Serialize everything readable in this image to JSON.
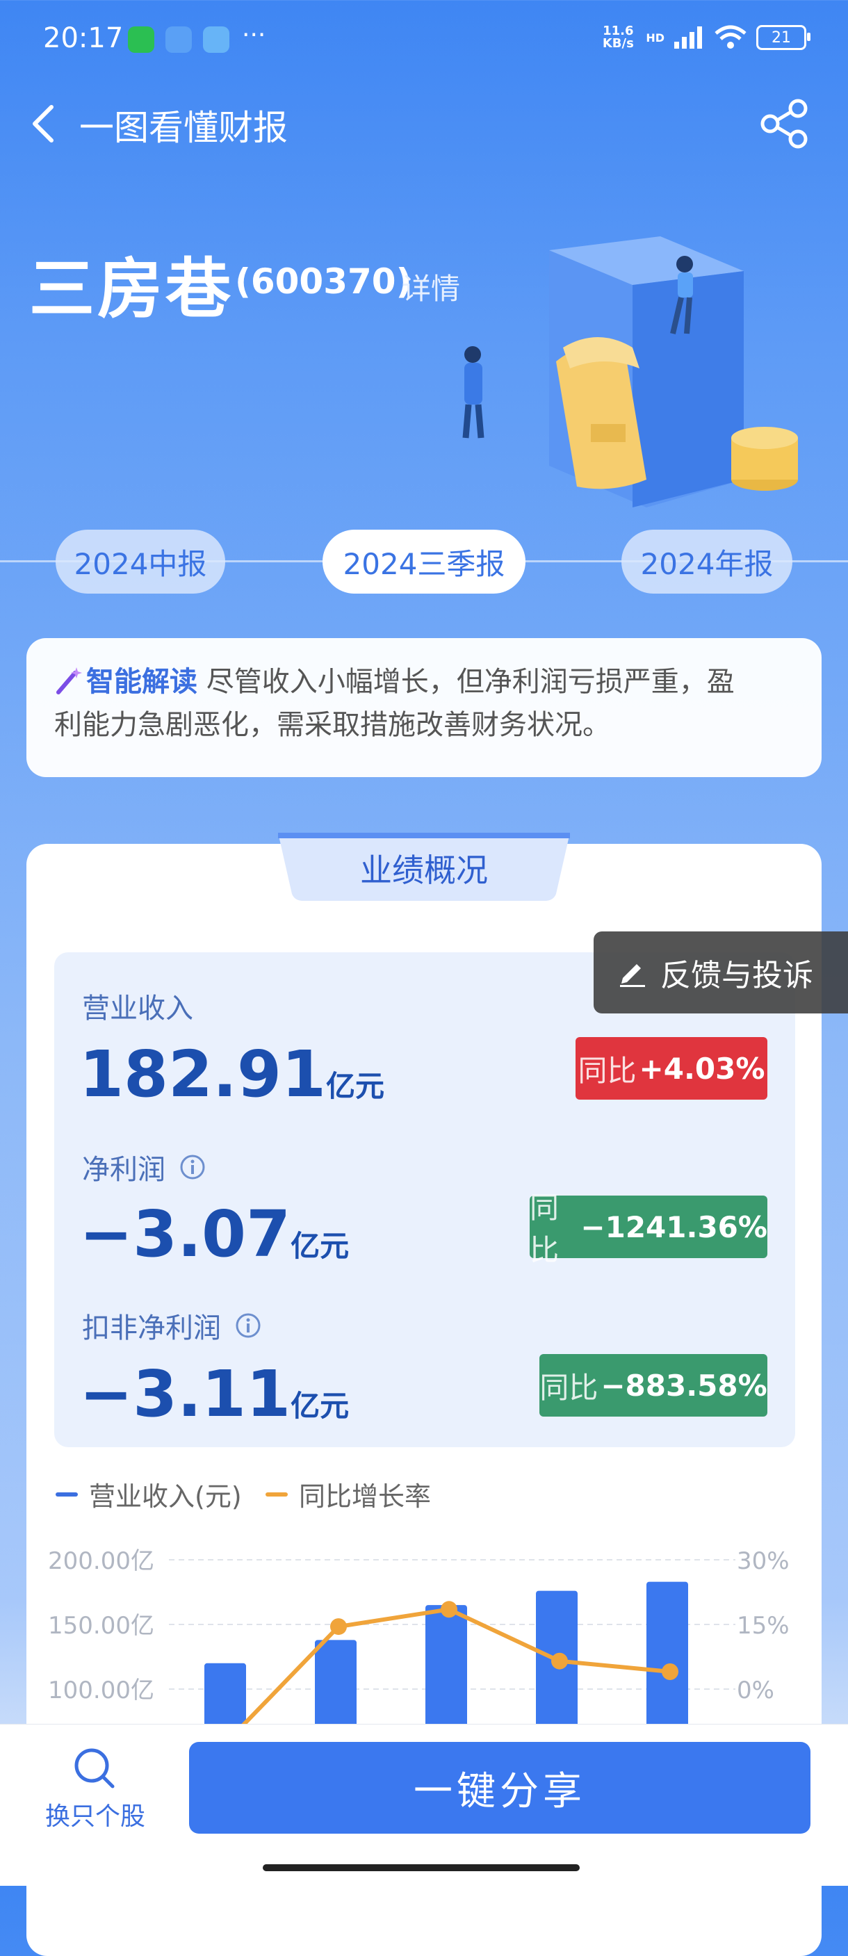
{
  "status_bar": {
    "time": "20:17",
    "network_speed": "11.6 KB/s",
    "hd": "HD",
    "battery": "21",
    "more": "···"
  },
  "header": {
    "title": "一图看懂财报",
    "back_icon": "chevron-left-icon",
    "share_icon": "share-icon"
  },
  "company": {
    "name": "三房巷",
    "code": "(600370)",
    "detail_link": "详情"
  },
  "periods": [
    {
      "label": "2024中报",
      "active": false
    },
    {
      "label": "2024三季报",
      "active": true
    },
    {
      "label": "2024年报",
      "active": false
    }
  ],
  "ai_summary": {
    "label": "智能解读",
    "line1": "尽管收入小幅增长，但净利润亏损严重，盈",
    "line2": "利能力急剧恶化，需采取措施改善财务状况。"
  },
  "section_title": "业绩概况",
  "feedback_label": "反馈与投诉",
  "metrics": [
    {
      "label": "营业收入",
      "value": "182.91",
      "unit": "亿元",
      "yoy_prefix": "同比",
      "yoy": "+4.03%",
      "color": "#e0353e"
    },
    {
      "label": "净利润",
      "value": "−3.07",
      "unit": "亿元",
      "yoy_prefix": "同比",
      "yoy": "−1241.36%",
      "color": "#3a9a6e"
    },
    {
      "label": "扣非净利润",
      "value": "−3.11",
      "unit": "亿元",
      "yoy_prefix": "同比",
      "yoy": "−883.58%",
      "color": "#3a9a6e"
    }
  ],
  "legend": {
    "revenue": "营业收入(元)",
    "growth": "同比增长率",
    "revenue_color": "#3b6fe0",
    "growth_color": "#f0a43a"
  },
  "chart_data": {
    "type": "bar",
    "series": [
      {
        "name": "营业收入(元)",
        "type": "bar",
        "values": [
          120,
          138,
          165,
          176,
          183
        ]
      },
      {
        "name": "同比增长率",
        "type": "line",
        "values": [
          -12,
          14.5,
          18.5,
          6.5,
          4.03
        ]
      }
    ],
    "y_left_ticks": [
      "200.00亿",
      "150.00亿",
      "100.00亿"
    ],
    "y_right_ticks": [
      "30%",
      "15%",
      "0%"
    ],
    "ylim_left": [
      100,
      200
    ],
    "ylim_right": [
      0,
      30
    ]
  },
  "bottom": {
    "switch_label": "换只个股",
    "share_label": "一键分享"
  }
}
